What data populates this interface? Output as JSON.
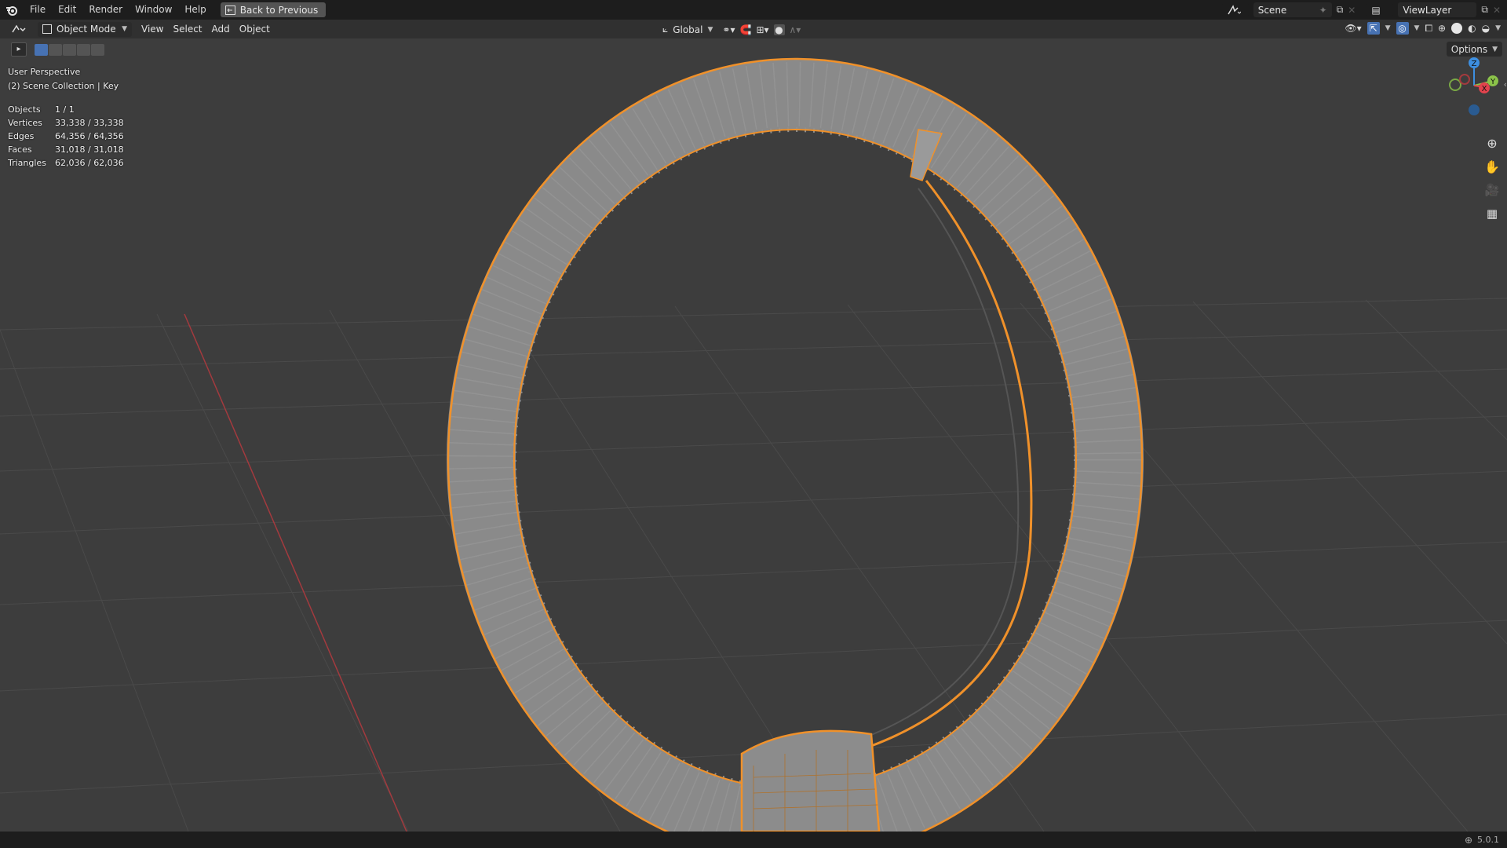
{
  "menu": {
    "file": "File",
    "edit": "Edit",
    "render": "Render",
    "window": "Window",
    "help": "Help"
  },
  "back_button": "Back to Previous",
  "scene": {
    "name": "Scene"
  },
  "view_layer": {
    "name": "ViewLayer"
  },
  "header": {
    "mode": "Object Mode",
    "view": "View",
    "select": "Select",
    "add": "Add",
    "object": "Object",
    "orientation": "Global",
    "options": "Options"
  },
  "viewport_info": {
    "perspective": "User Perspective",
    "collection": "(2) Scene Collection | Key"
  },
  "stats": [
    {
      "label": "Objects",
      "value": "1 / 1"
    },
    {
      "label": "Vertices",
      "value": "33,338 / 33,338"
    },
    {
      "label": "Edges",
      "value": "64,356 / 64,356"
    },
    {
      "label": "Faces",
      "value": "31,018 / 31,018"
    },
    {
      "label": "Triangles",
      "value": "62,036 / 62,036"
    }
  ],
  "gizmo": {
    "x": "X",
    "y": "Y",
    "z": "Z"
  },
  "version": "5.0.1",
  "colors": {
    "accent": "#f0912a",
    "selected_outline": "#ffa033",
    "x_axis": "#e2434d",
    "y_axis": "#8bc34a",
    "z_axis": "#3d8fe0"
  }
}
